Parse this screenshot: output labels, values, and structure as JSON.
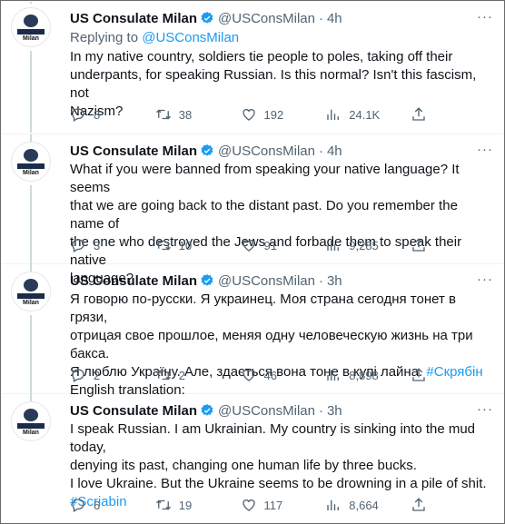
{
  "account": {
    "name": "US Consulate Milan",
    "handle": "@USConsMilan",
    "avatar_text": "Milan"
  },
  "tweets": [
    {
      "time": "4h",
      "replying_prefix": "Replying to",
      "replying_to": "@USConsMilan",
      "lines": [
        "In my native country, soldiers tie people to poles, taking off their",
        "underpants, for speaking Russian. Is this normal? Isn't this fascism, not",
        "Nazism?"
      ],
      "replies": "8",
      "retweets": "38",
      "likes": "192",
      "views": "24.1K"
    },
    {
      "time": "4h",
      "lines": [
        "What if you were banned from speaking your native language? It seems",
        "that we are going back to the distant past. Do you remember the name of",
        "the one who destroyed the Jews and forbade them to speak their native",
        "language?"
      ],
      "replies": "3",
      "retweets": "10",
      "likes": "91",
      "views": "9,285"
    },
    {
      "time": "3h",
      "lines": [
        "Я говорю по-русски. Я украинец. Моя страна сегодня тонет в грязи,",
        "отрицая свое прошлое, меняя одну человеческую жизнь на три бакса.",
        "Я люблю Україну. Але, здається вона тоне в купі лайна.",
        "English translation:"
      ],
      "hashtag": "#Скрябін",
      "replies": "2",
      "retweets": "2",
      "likes": "46",
      "views": "8,898"
    },
    {
      "time": "3h",
      "lines": [
        "I speak Russian. I am Ukrainian. My country is sinking into the mud today,",
        "denying its past, changing one human life by three bucks.",
        "I love Ukraine. But the Ukraine seems to be drowning in a pile of shit."
      ],
      "hashtag": "#Scriabin",
      "replies": "6",
      "retweets": "19",
      "likes": "117",
      "views": "8,664"
    }
  ],
  "colors": {
    "accent": "#1d9bf0",
    "muted": "#536471",
    "text": "#0f1419"
  },
  "icons": [
    "verified-badge-icon",
    "reply-icon",
    "retweet-icon",
    "like-icon",
    "views-icon",
    "share-icon",
    "more-icon"
  ]
}
